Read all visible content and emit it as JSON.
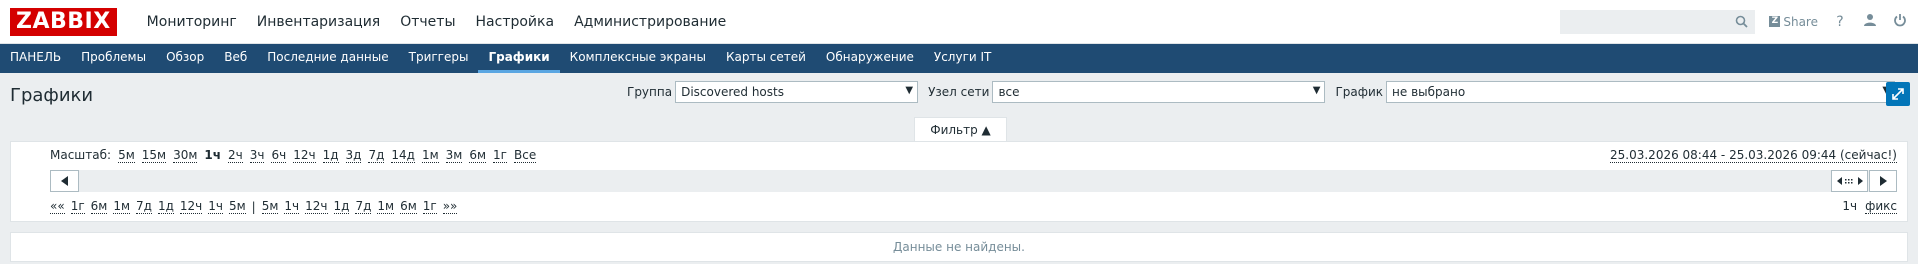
{
  "header": {
    "logo": "ZABBIX",
    "nav": [
      "Мониторинг",
      "Инвентаризация",
      "Отчеты",
      "Настройка",
      "Администрирование"
    ],
    "search_placeholder": "",
    "share_label": "Share",
    "help": "?"
  },
  "subnav": [
    "ПАНЕЛЬ",
    "Проблемы",
    "Обзор",
    "Веб",
    "Последние данные",
    "Триггеры",
    "Графики",
    "Комплексные экраны",
    "Карты сетей",
    "Обнаружение",
    "Услуги IT"
  ],
  "page": {
    "title": "Графики",
    "group_label": "Группа",
    "group_value": "Discovered hosts",
    "host_label": "Узел сети",
    "host_value": "все",
    "graph_label": "График",
    "graph_value": "не выбрано"
  },
  "filter": {
    "tab_label": "Фильтр ▲",
    "zoom_label": "Масштаб:",
    "zoom_options": [
      "5м",
      "15м",
      "30м",
      "1ч",
      "2ч",
      "3ч",
      "6ч",
      "12ч",
      "1д",
      "3д",
      "7д",
      "14д",
      "1м",
      "3м",
      "6м",
      "1г",
      "Все"
    ],
    "zoom_active": "1ч",
    "range": "25.03.2026 08:44 - 25.03.2026 09:44 (сейчас!)",
    "back_links": [
      "««",
      "1г",
      "6м",
      "1м",
      "7д",
      "1д",
      "12ч",
      "1ч",
      "5м"
    ],
    "separator": "|",
    "forward_links": [
      "5м",
      "1ч",
      "12ч",
      "1д",
      "7д",
      "1м",
      "6м",
      "1г",
      "»»"
    ],
    "period": "1ч",
    "fixed": "фикс"
  },
  "result": {
    "empty_text": "Данные не найдены."
  }
}
